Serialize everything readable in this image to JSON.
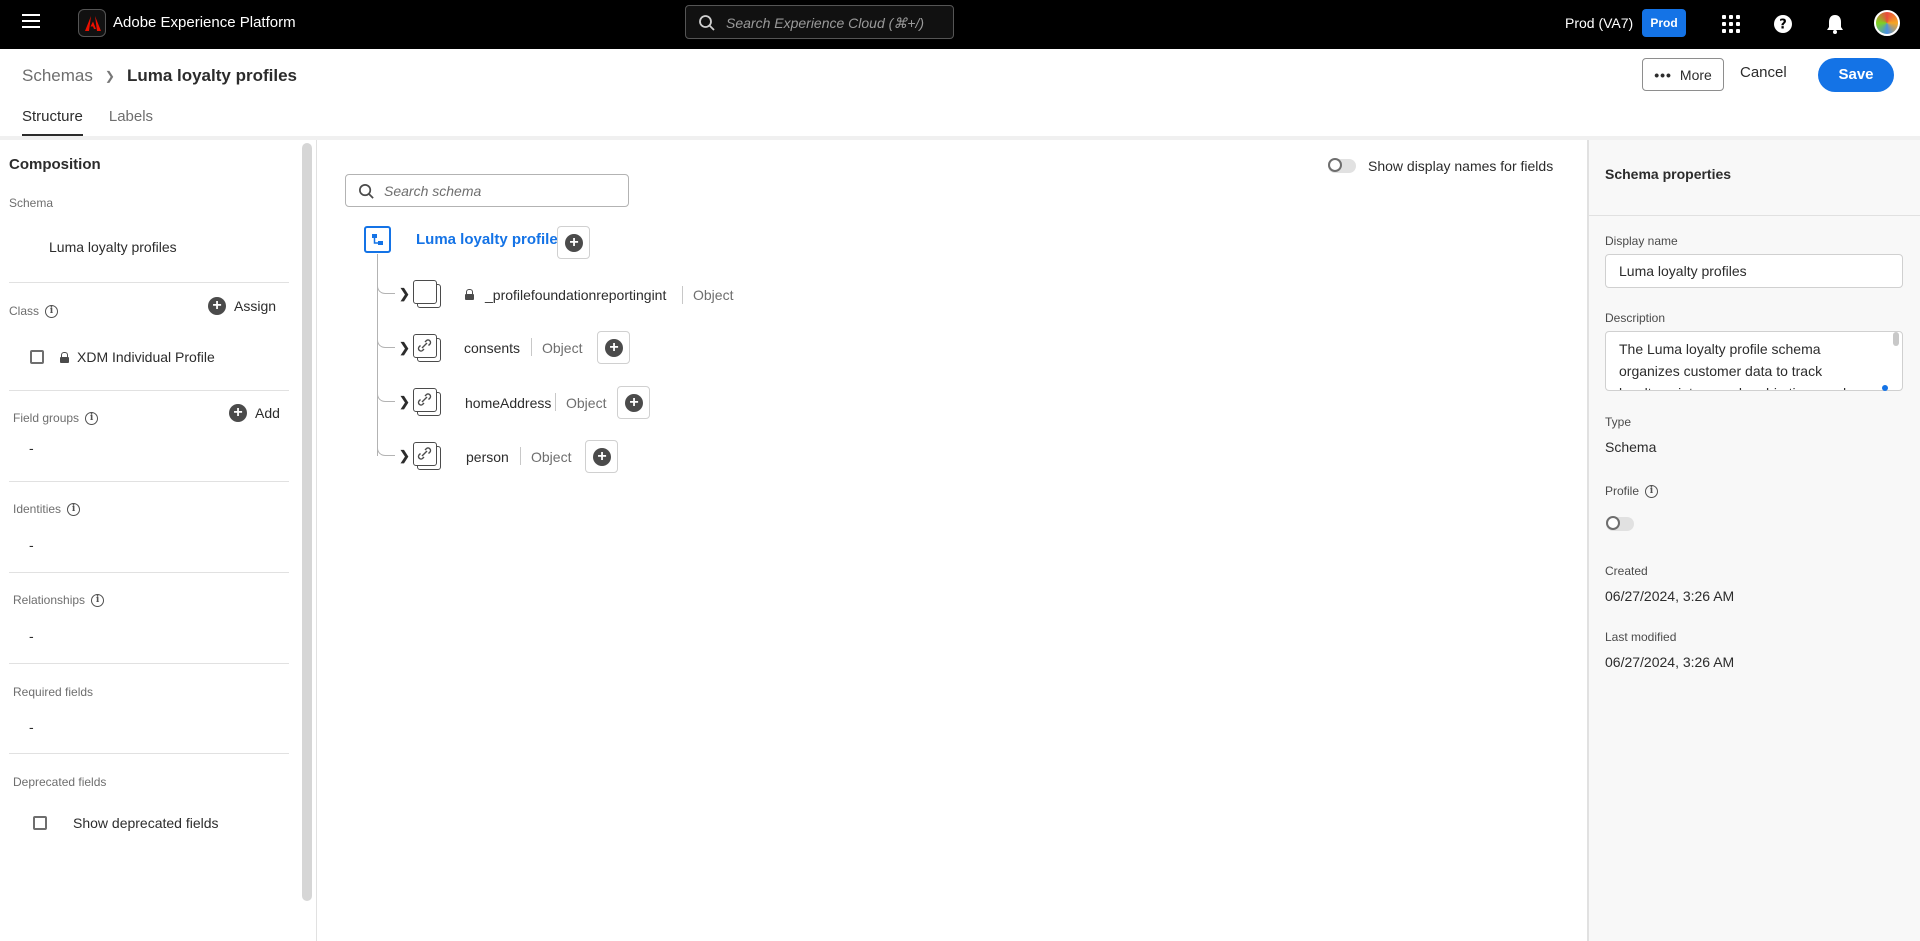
{
  "topbar": {
    "app_title": "Adobe Experience Platform",
    "search_placeholder": "Search Experience Cloud (⌘+/)",
    "sandbox": "Prod (VA7)",
    "env_badge": "Prod"
  },
  "header": {
    "breadcrumb_parent": "Schemas",
    "breadcrumb_current": "Luma loyalty profiles",
    "more_label": "More",
    "cancel_label": "Cancel",
    "save_label": "Save",
    "tabs": [
      {
        "label": "Structure",
        "active": true
      },
      {
        "label": "Labels",
        "active": false
      }
    ]
  },
  "composition": {
    "title": "Composition",
    "schema_label": "Schema",
    "schema_name": "Luma loyalty profiles",
    "class_label": "Class",
    "assign_label": "Assign",
    "class_name": "XDM Individual Profile",
    "field_groups_label": "Field groups",
    "add_label": "Add",
    "field_groups_value": "-",
    "identities_label": "Identities",
    "identities_value": "-",
    "relationships_label": "Relationships",
    "relationships_value": "-",
    "required_fields_label": "Required fields",
    "required_fields_value": "-",
    "deprecated_fields_label": "Deprecated fields",
    "show_deprecated_label": "Show deprecated fields"
  },
  "canvas": {
    "search_placeholder": "Search schema",
    "display_names_toggle": "Show display names for fields",
    "root_name": "Luma loyalty profiles",
    "fields": [
      {
        "name": "_profilefoundationreportingint",
        "type": "Object",
        "locked": true,
        "linked": false
      },
      {
        "name": "consents",
        "type": "Object",
        "locked": false,
        "linked": true
      },
      {
        "name": "homeAddress",
        "type": "Object",
        "locked": false,
        "linked": true
      },
      {
        "name": "person",
        "type": "Object",
        "locked": false,
        "linked": true
      }
    ]
  },
  "properties": {
    "title": "Schema properties",
    "display_name_label": "Display name",
    "display_name_value": "Luma loyalty profiles",
    "description_label": "Description",
    "description_value": "The Luma loyalty profile schema organizes customer data to track loyalty points, membership tiers, and reward",
    "type_label": "Type",
    "type_value": "Schema",
    "profile_label": "Profile",
    "profile_enabled": false,
    "created_label": "Created",
    "created_value": "06/27/2024, 3:26 AM",
    "modified_label": "Last modified",
    "modified_value": "06/27/2024, 3:26 AM"
  },
  "colors": {
    "accent": "#1473e6",
    "topbar": "#000000"
  }
}
